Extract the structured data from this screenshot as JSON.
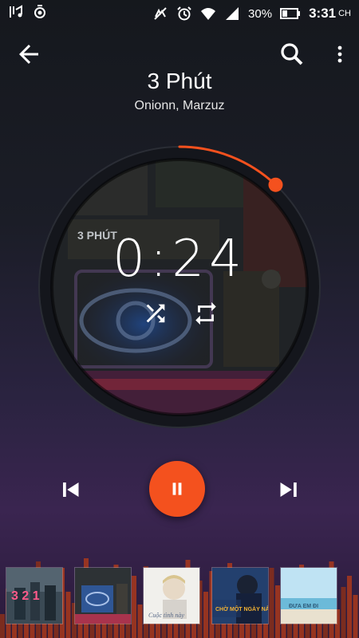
{
  "status_bar": {
    "battery_percent": "30%",
    "time": "3:31",
    "time_suffix": "CH",
    "icons": [
      "music-notification-icon",
      "podcast-notification-icon",
      "mute-icon",
      "alarm-icon",
      "wifi-icon",
      "signal-icon",
      "battery-icon"
    ]
  },
  "header": {
    "back_icon": "arrow-left-icon",
    "search_icon": "search-icon",
    "more_icon": "more-vert-icon"
  },
  "track": {
    "title": "3 Phút",
    "artist": "Onionn, Marzuz",
    "elapsed": "0:24",
    "progress_fraction": 0.12,
    "artwork_text": "3 PHÚT"
  },
  "player_controls": {
    "shuffle_icon": "shuffle-icon",
    "repeat_icon": "repeat-icon",
    "previous_icon": "skip-previous-icon",
    "pause_icon": "pause-icon",
    "next_icon": "skip-next-icon"
  },
  "colors": {
    "accent": "#f4511e",
    "background_top": "#15181d",
    "background_bottom": "#3a2550"
  },
  "queue": [
    {
      "cover_text": "3 2 1"
    },
    {
      "cover_text": ""
    },
    {
      "cover_text": "Cuộc tình này"
    },
    {
      "cover_text": "CHỜ MỘT NGÀY NẮNG"
    },
    {
      "cover_text": "ĐƯA EM ĐI"
    }
  ]
}
